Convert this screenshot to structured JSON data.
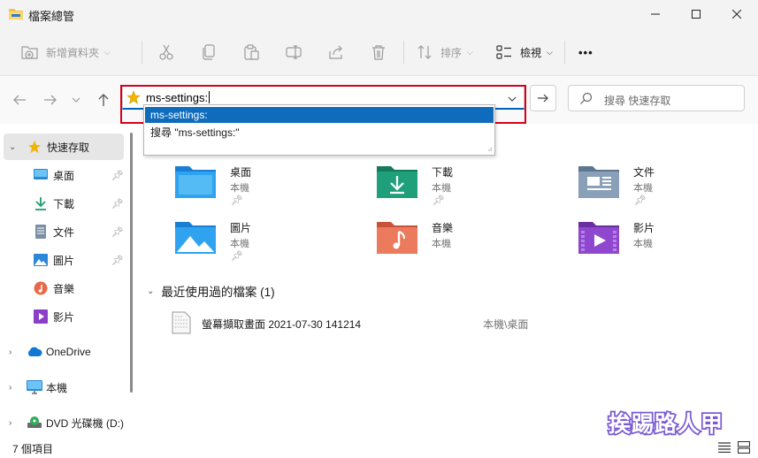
{
  "window": {
    "title": "檔案總管"
  },
  "toolbar": {
    "new_folder": "新增資料夾",
    "sort": "排序",
    "view": "檢視",
    "more": "•••"
  },
  "address": {
    "value": "ms-settings:",
    "search_placeholder": "搜尋 快速存取"
  },
  "autocomplete": {
    "items": [
      "ms-settings:",
      "搜尋 \"ms-settings:\""
    ]
  },
  "sidebar": {
    "quick_access": "快速存取",
    "items": [
      {
        "label": "桌面",
        "icon": "desktop-icon",
        "pinned": true
      },
      {
        "label": "下載",
        "icon": "download-icon",
        "pinned": true
      },
      {
        "label": "文件",
        "icon": "documents-icon",
        "pinned": true
      },
      {
        "label": "圖片",
        "icon": "pictures-icon",
        "pinned": true
      },
      {
        "label": "音樂",
        "icon": "music-icon",
        "pinned": false
      },
      {
        "label": "影片",
        "icon": "videos-icon",
        "pinned": false
      }
    ],
    "onedrive": "OneDrive",
    "this_pc": "本機",
    "dvd": "DVD 光碟機 (D:)"
  },
  "main": {
    "folders": [
      {
        "name": "桌面",
        "location": "本機",
        "pinned": true,
        "icon": "desktop-folder-icon"
      },
      {
        "name": "下載",
        "location": "本機",
        "pinned": true,
        "icon": "downloads-folder-icon"
      },
      {
        "name": "文件",
        "location": "本機",
        "pinned": true,
        "icon": "documents-folder-icon"
      },
      {
        "name": "圖片",
        "location": "本機",
        "pinned": true,
        "icon": "pictures-folder-icon"
      },
      {
        "name": "音樂",
        "location": "本機",
        "pinned": false,
        "icon": "music-folder-icon"
      },
      {
        "name": "影片",
        "location": "本機",
        "pinned": false,
        "icon": "videos-folder-icon"
      }
    ],
    "recent_header": "最近使用過的檔案 (1)",
    "recent_files": [
      {
        "name": "螢幕擷取畫面 2021-07-30 141214",
        "location": "本機\\桌面"
      }
    ]
  },
  "status": {
    "items_count": "7 個項目"
  },
  "watermark": "挨踢路人甲",
  "colors": {
    "accent": "#0f6cbd",
    "highlight_frame": "#d6001c",
    "star": "#f0b400"
  }
}
